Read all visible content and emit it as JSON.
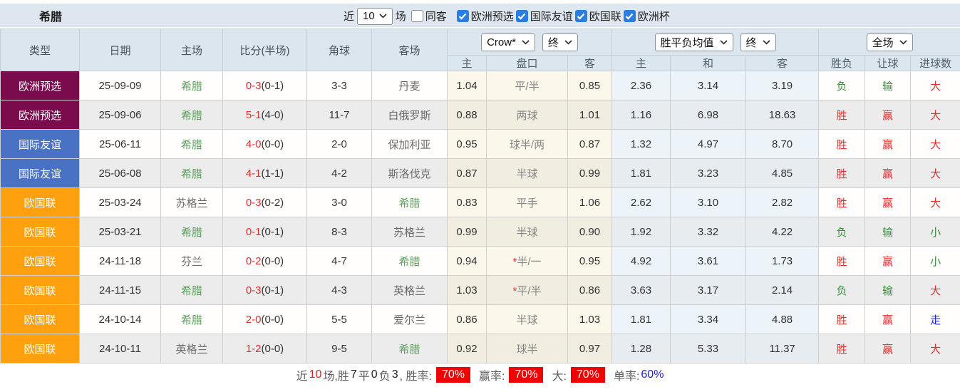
{
  "header_bar": {
    "team": "希腊",
    "recent_label": "近",
    "recent_value": "10",
    "matches_label": "场",
    "same_venue_label": "同客",
    "same_venue_checked": false,
    "filters": [
      {
        "label": "欧洲预选",
        "checked": true
      },
      {
        "label": "国际友谊",
        "checked": true
      },
      {
        "label": "欧国联",
        "checked": true
      },
      {
        "label": "欧洲杯",
        "checked": true
      }
    ]
  },
  "table": {
    "columns": [
      "类型",
      "日期",
      "主场",
      "比分(半场)",
      "角球",
      "客场"
    ],
    "selects": {
      "odds_company": "Crow*",
      "odds_time": "终",
      "avg_label": "胜平负均值",
      "avg_time": "终",
      "scope": "全场"
    },
    "sub_columns": [
      "主",
      "盘口",
      "客",
      "主",
      "和",
      "客",
      "胜负",
      "让球",
      "进球数"
    ],
    "type_colors": {
      "欧洲预选": "#7a0b4d",
      "国际友谊": "#4a72c4",
      "欧国联": "#ffa10f"
    },
    "accent_colors": {
      "red": "#e62e2e",
      "green": "#3a8f3a",
      "blue": "#2424e0"
    },
    "rows": [
      {
        "type": "欧洲预选",
        "date": "25-09-09",
        "home": "希腊",
        "home_highlight": true,
        "score_ft": "0-3",
        "score_ht": "(0-1)",
        "corners": "3-3",
        "away": "丹麦",
        "away_highlight": false,
        "odds_home": "1.04",
        "handicap_star": "",
        "handicap": "平/半",
        "odds_away": "0.85",
        "avg_home": "2.36",
        "avg_draw": "3.14",
        "avg_away": "3.19",
        "result": "负",
        "result_color": "green",
        "spread": "输",
        "spread_color": "green",
        "total": "大",
        "total_color": "red"
      },
      {
        "type": "欧洲预选",
        "date": "25-09-06",
        "home": "希腊",
        "home_highlight": true,
        "score_ft": "5-1",
        "score_ht": "(4-0)",
        "corners": "11-7",
        "away": "白俄罗斯",
        "away_highlight": false,
        "odds_home": "0.88",
        "handicap_star": "",
        "handicap": "两球",
        "odds_away": "1.01",
        "avg_home": "1.16",
        "avg_draw": "6.98",
        "avg_away": "18.63",
        "result": "胜",
        "result_color": "red",
        "spread": "赢",
        "spread_color": "red",
        "total": "大",
        "total_color": "red"
      },
      {
        "type": "国际友谊",
        "date": "25-06-11",
        "home": "希腊",
        "home_highlight": true,
        "score_ft": "4-0",
        "score_ht": "(0-0)",
        "corners": "2-0",
        "away": "保加利亚",
        "away_highlight": false,
        "odds_home": "0.95",
        "handicap_star": "",
        "handicap": "球半/两",
        "odds_away": "0.87",
        "avg_home": "1.32",
        "avg_draw": "4.97",
        "avg_away": "8.70",
        "result": "胜",
        "result_color": "red",
        "spread": "赢",
        "spread_color": "red",
        "total": "大",
        "total_color": "red"
      },
      {
        "type": "国际友谊",
        "date": "25-06-08",
        "home": "希腊",
        "home_highlight": true,
        "score_ft": "4-1",
        "score_ht": "(1-1)",
        "corners": "4-2",
        "away": "斯洛伐克",
        "away_highlight": false,
        "odds_home": "0.87",
        "handicap_star": "",
        "handicap": "半球",
        "odds_away": "0.99",
        "avg_home": "1.81",
        "avg_draw": "3.23",
        "avg_away": "4.85",
        "result": "胜",
        "result_color": "red",
        "spread": "赢",
        "spread_color": "red",
        "total": "大",
        "total_color": "red"
      },
      {
        "type": "欧国联",
        "date": "25-03-24",
        "home": "苏格兰",
        "home_highlight": false,
        "score_ft": "0-3",
        "score_ht": "(0-2)",
        "corners": "3-0",
        "away": "希腊",
        "away_highlight": true,
        "odds_home": "0.83",
        "handicap_star": "",
        "handicap": "平手",
        "odds_away": "1.06",
        "avg_home": "2.62",
        "avg_draw": "3.10",
        "avg_away": "2.82",
        "result": "胜",
        "result_color": "red",
        "spread": "赢",
        "spread_color": "red",
        "total": "大",
        "total_color": "red"
      },
      {
        "type": "欧国联",
        "date": "25-03-21",
        "home": "希腊",
        "home_highlight": true,
        "score_ft": "0-1",
        "score_ht": "(0-1)",
        "corners": "8-3",
        "away": "苏格兰",
        "away_highlight": false,
        "odds_home": "0.99",
        "handicap_star": "",
        "handicap": "半球",
        "odds_away": "0.90",
        "avg_home": "1.92",
        "avg_draw": "3.32",
        "avg_away": "4.22",
        "result": "负",
        "result_color": "green",
        "spread": "输",
        "spread_color": "green",
        "total": "小",
        "total_color": "green"
      },
      {
        "type": "欧国联",
        "date": "24-11-18",
        "home": "芬兰",
        "home_highlight": false,
        "score_ft": "0-2",
        "score_ht": "(0-0)",
        "corners": "4-7",
        "away": "希腊",
        "away_highlight": true,
        "odds_home": "0.94",
        "handicap_star": "*",
        "handicap": "半/一",
        "odds_away": "0.95",
        "avg_home": "4.92",
        "avg_draw": "3.61",
        "avg_away": "1.73",
        "result": "胜",
        "result_color": "red",
        "spread": "赢",
        "spread_color": "red",
        "total": "小",
        "total_color": "green"
      },
      {
        "type": "欧国联",
        "date": "24-11-15",
        "home": "希腊",
        "home_highlight": true,
        "score_ft": "0-3",
        "score_ht": "(0-1)",
        "corners": "4-3",
        "away": "英格兰",
        "away_highlight": false,
        "odds_home": "1.03",
        "handicap_star": "*",
        "handicap": "平/半",
        "odds_away": "0.86",
        "avg_home": "3.63",
        "avg_draw": "3.17",
        "avg_away": "2.14",
        "result": "负",
        "result_color": "green",
        "spread": "输",
        "spread_color": "green",
        "total": "大",
        "total_color": "red"
      },
      {
        "type": "欧国联",
        "date": "24-10-14",
        "home": "希腊",
        "home_highlight": true,
        "score_ft": "2-0",
        "score_ht": "(0-0)",
        "corners": "5-5",
        "away": "爱尔兰",
        "away_highlight": false,
        "odds_home": "0.86",
        "handicap_star": "",
        "handicap": "半球",
        "odds_away": "1.03",
        "avg_home": "1.81",
        "avg_draw": "3.34",
        "avg_away": "4.88",
        "result": "胜",
        "result_color": "red",
        "spread": "赢",
        "spread_color": "red",
        "total": "走",
        "total_color": "blue"
      },
      {
        "type": "欧国联",
        "date": "24-10-11",
        "home": "英格兰",
        "home_highlight": false,
        "score_ft": "1-2",
        "score_ht": "(0-0)",
        "corners": "9-5",
        "away": "希腊",
        "away_highlight": true,
        "odds_home": "0.92",
        "handicap_star": "",
        "handicap": "球半",
        "odds_away": "0.97",
        "avg_home": "1.28",
        "avg_draw": "5.33",
        "avg_away": "11.37",
        "result": "胜",
        "result_color": "red",
        "spread": "赢",
        "spread_color": "red",
        "total": "大",
        "total_color": "red"
      }
    ]
  },
  "footer": {
    "recent_prefix": "近",
    "recent_count": "10",
    "seg1": "场,胜",
    "wins": "7",
    "seg2": "平",
    "draws": "0",
    "seg3": "负",
    "losses": "3",
    "win_rate_label": ", 胜率:",
    "win_rate": "70%",
    "handicap_rate_label": "赢率:",
    "handicap_rate": "70%",
    "over_rate_label": "大:",
    "over_rate": "70%",
    "single_rate_label": "单率:",
    "single_rate": "60%"
  }
}
